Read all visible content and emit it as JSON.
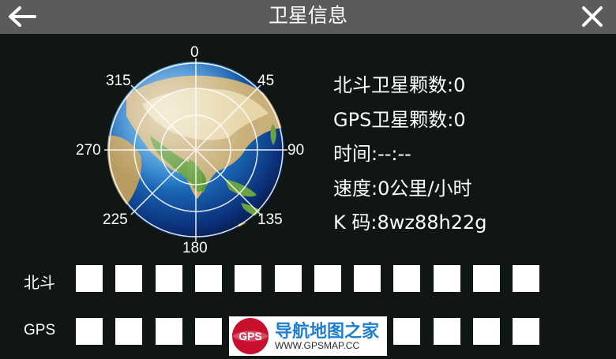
{
  "header": {
    "title": "卫星信息"
  },
  "compass": {
    "n": "0",
    "ne": "45",
    "e": "90",
    "se": "135",
    "s": "180",
    "sw": "225",
    "w": "270",
    "nw": "315"
  },
  "info": {
    "beidou_count": "北斗卫星颗数:0",
    "gps_count": "GPS卫星颗数:0",
    "time": "时间:--:--",
    "speed": "速度:0公里/小时",
    "k_code": "K 码:8wz88h22g"
  },
  "signal_rows": {
    "beidou_label": "北斗",
    "gps_label": "GPS"
  },
  "watermark": {
    "badge": "GPS",
    "title": "导航地图之家",
    "url": "WWW.GPSMAP.CC"
  },
  "colors": {
    "header_bg": "#5b5b5b",
    "page_bg": "#0f1614",
    "slot": "#ffffff",
    "watermark_blue": "#1e7fd0",
    "watermark_red": "#c8102e"
  },
  "icons": {
    "back": "arrow-left-icon",
    "close": "close-icon",
    "globe": "globe-icon"
  }
}
